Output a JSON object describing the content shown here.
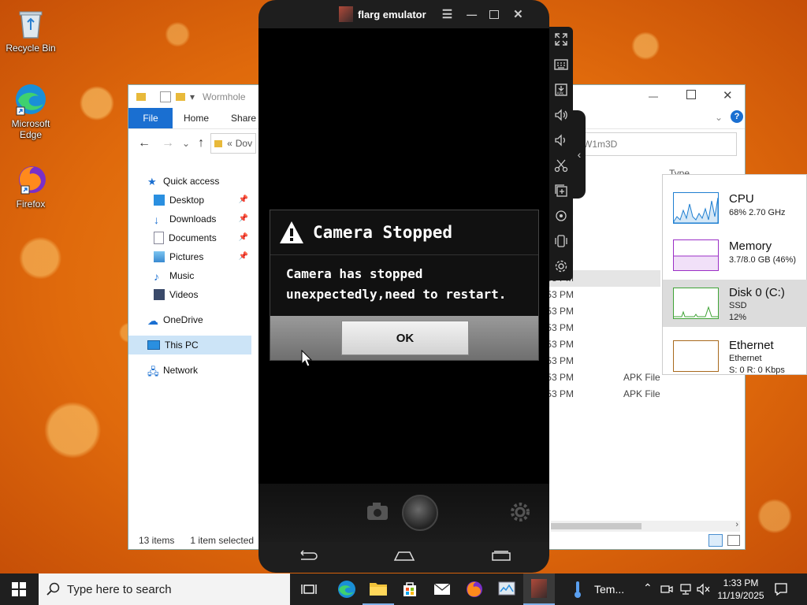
{
  "desktop": {
    "icons": [
      {
        "label": "Recycle Bin"
      },
      {
        "label": "Microsoft Edge"
      },
      {
        "label": "Firefox"
      }
    ]
  },
  "explorer": {
    "title": "Wormhole",
    "ribbon_tabs": [
      "File",
      "Home",
      "Share"
    ],
    "address": "Dov",
    "search_fragment": "W1m3D",
    "column_header": "Type",
    "nav": {
      "quick_access": "Quick access",
      "items": [
        {
          "label": "Desktop",
          "pinned": true
        },
        {
          "label": "Downloads",
          "pinned": true
        },
        {
          "label": "Documents",
          "pinned": true
        },
        {
          "label": "Pictures",
          "pinned": true
        },
        {
          "label": "Music",
          "pinned": false
        },
        {
          "label": "Videos",
          "pinned": false
        }
      ],
      "onedrive": "OneDrive",
      "this_pc": "This PC",
      "network": "Network"
    },
    "rows": [
      {
        "date": "12:53 PM",
        "type": ""
      },
      {
        "date": "12:53 PM",
        "type": ""
      },
      {
        "date": "12:53 PM",
        "type": ""
      },
      {
        "date": "12:53 PM",
        "type": ""
      },
      {
        "date": "12:53 PM",
        "type": ""
      },
      {
        "date": "12:53 PM",
        "type": ""
      },
      {
        "date": "2025 12:53 PM",
        "type": ""
      },
      {
        "date": "2025 12:53 PM",
        "type": ""
      },
      {
        "date": "2025 12:53 PM",
        "type": ""
      },
      {
        "date": "2025 12:53 PM",
        "type": ""
      },
      {
        "date": "2025 12:53 PM",
        "type": ""
      },
      {
        "date": "2025 12:53 PM",
        "type": "APK File"
      },
      {
        "date": "2025 12:53 PM",
        "type": "APK File"
      }
    ],
    "status_items": "13 items",
    "status_selected": "1 item selected"
  },
  "perf": {
    "cpu": {
      "name": "CPU",
      "detail": "68% 2.70 GHz",
      "color": "#1f7fd1"
    },
    "memory": {
      "name": "Memory",
      "detail": "3.7/8.0 GB (46%)",
      "color": "#9b2fc6"
    },
    "disk": {
      "name": "Disk 0 (C:)",
      "line1": "SSD",
      "line2": "12%",
      "color": "#3fa336"
    },
    "ethernet": {
      "name": "Ethernet",
      "line1": "Ethernet",
      "line2": "S: 0 R: 0 Kbps",
      "color": "#a8691c"
    }
  },
  "emulator": {
    "title": "flarg emulator",
    "dialog": {
      "title": "Camera Stopped",
      "line1": "Camera has stopped",
      "line2": "unexpectedly,need to restart.",
      "ok": "OK"
    }
  },
  "taskbar": {
    "search_placeholder": "Type here to search",
    "temp_label": "Tem...",
    "time": "1:33 PM",
    "date": "11/19/2025"
  }
}
